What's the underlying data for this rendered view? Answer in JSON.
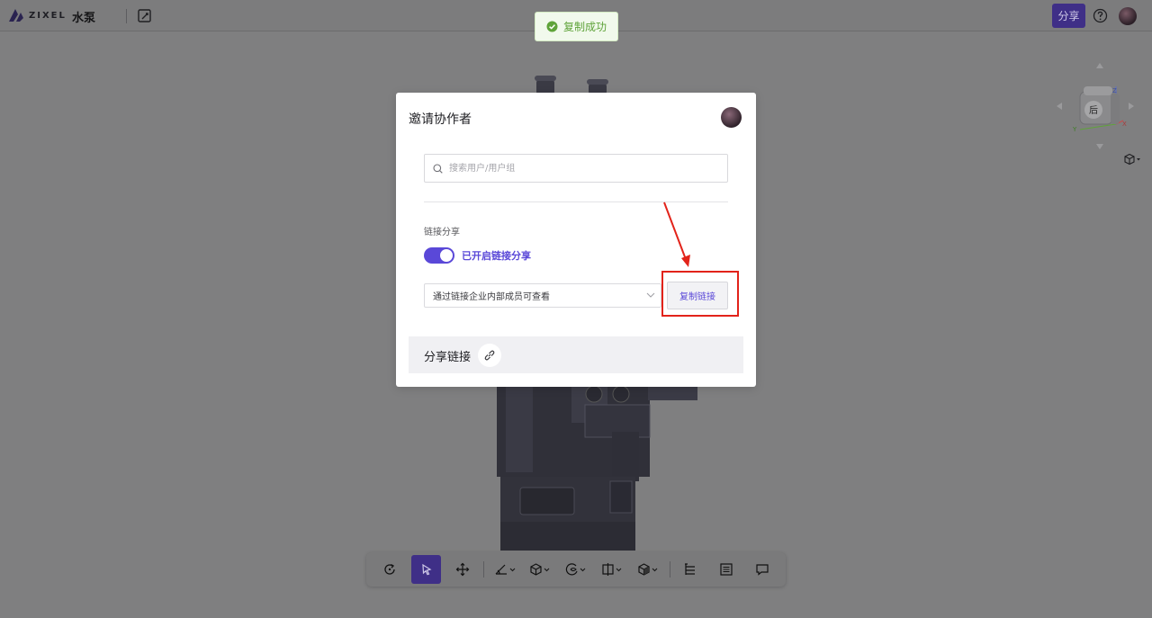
{
  "app": {
    "logo_text": "ZIXEL",
    "doc_title": "水泵",
    "share_label": "分享"
  },
  "toast": {
    "message": "复制成功",
    "status_color": "#5fa33a"
  },
  "viewcube": {
    "face_label": "后",
    "axis_labels": [
      "Z",
      "X",
      "Y"
    ]
  },
  "modal": {
    "title": "邀请协作者",
    "search_placeholder": "搜索用户/用户组",
    "link_section_label": "链接分享",
    "toggle_label": "已开启链接分享",
    "toggle_on": true,
    "permission_value": "通过链接企业内部成员可查看",
    "copy_button_label": "复制链接",
    "share_link_label": "分享链接",
    "accent_color": "#5a48d8",
    "annotation_color": "#e2231a"
  },
  "toolbar": {
    "items": [
      {
        "icon": "rotate-icon"
      },
      {
        "icon": "select-cursor-icon",
        "active": true
      },
      {
        "icon": "move-icon"
      },
      {
        "icon": "measure-icon",
        "dropdown": true
      },
      {
        "icon": "explode-icon",
        "dropdown": true
      },
      {
        "icon": "material-icon",
        "dropdown": true
      },
      {
        "icon": "section-icon",
        "dropdown": true
      },
      {
        "icon": "view-mode-icon",
        "dropdown": true
      },
      {
        "icon": "structure-tree-icon"
      },
      {
        "icon": "properties-icon"
      },
      {
        "icon": "comment-icon"
      }
    ]
  }
}
